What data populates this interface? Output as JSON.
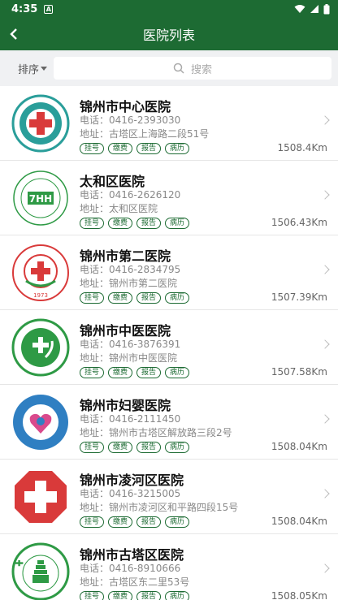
{
  "status_bar": {
    "time": "4:35"
  },
  "app_bar": {
    "title": "医院列表"
  },
  "search": {
    "sort_label": "排序",
    "placeholder": "搜索"
  },
  "colors": {
    "primary": "#1d6b33",
    "logo_red": "#d93a3a",
    "logo_blue": "#2f7fc2",
    "logo_teal": "#2a9e9a",
    "logo_green": "#2e9a45"
  },
  "hospitals": [
    {
      "name": "锦州市中心医院",
      "phone": "电话：0416-2393030",
      "address": "地址：古塔区上海路二段51号",
      "tags": [
        "挂号",
        "缴费",
        "报告",
        "病历"
      ],
      "distance": "1508.4Km",
      "logo": "teal-cross-logo"
    },
    {
      "name": "太和区医院",
      "phone": "电话：0416-2626120",
      "address": "地址：太和区医院",
      "tags": [
        "挂号",
        "缴费",
        "报告",
        "病历"
      ],
      "distance": "1506.43Km",
      "logo": "thh-green-logo"
    },
    {
      "name": "锦州市第二医院",
      "phone": "电话：0416-2834795",
      "address": "地址：锦州市第二医院",
      "tags": [
        "挂号",
        "缴费",
        "报告",
        "病历"
      ],
      "distance": "1507.39Km",
      "logo": "red-cross-logo"
    },
    {
      "name": "锦州市中医医院",
      "phone": "电话：0416-3876391",
      "address": "地址：锦州市中医医院",
      "tags": [
        "挂号",
        "缴费",
        "报告",
        "病历"
      ],
      "distance": "1507.58Km",
      "logo": "green-leaf-logo"
    },
    {
      "name": "锦州市妇婴医院",
      "phone": "电话：0416-2111450",
      "address": "地址：锦州市古塔区解放路三段2号",
      "tags": [
        "挂号",
        "缴费",
        "报告",
        "病历"
      ],
      "distance": "1508.04Km",
      "logo": "blue-heart-logo"
    },
    {
      "name": "锦州市凌河区医院",
      "phone": "电话：0416-3215005",
      "address": "地址：锦州市凌河区和平路四段15号",
      "tags": [
        "挂号",
        "缴费",
        "报告",
        "病历"
      ],
      "distance": "1508.04Km",
      "logo": "red-octagon-logo"
    },
    {
      "name": "锦州市古塔区医院",
      "phone": "电话：0416-8910666",
      "address": "地址：古塔区东二里53号",
      "tags": [
        "挂号",
        "缴费",
        "报告",
        "病历"
      ],
      "distance": "1508.05Km",
      "logo": "tower-logo"
    }
  ],
  "logo_texts": {
    "logo_1_year": "1973",
    "logo_7_year": "1960",
    "logo_7_text": "古塔医院"
  }
}
